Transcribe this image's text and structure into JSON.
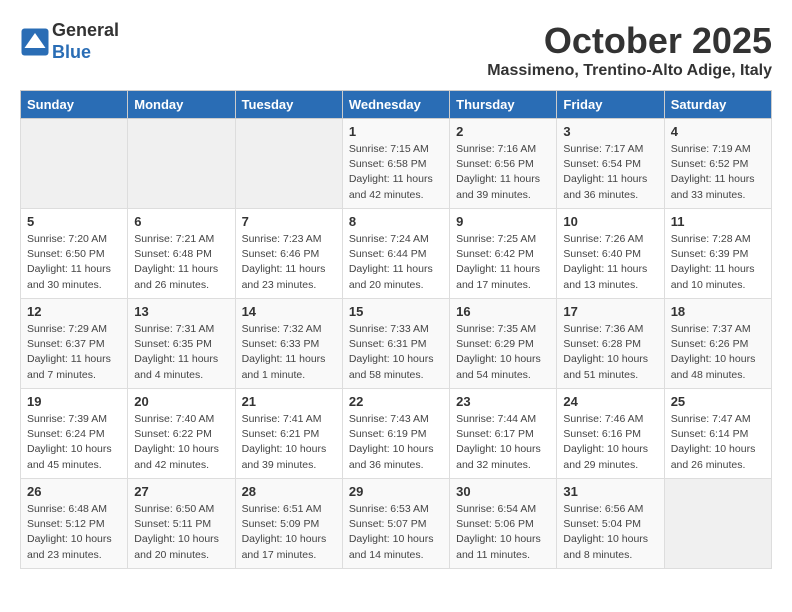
{
  "header": {
    "logo_line1": "General",
    "logo_line2": "Blue",
    "month": "October 2025",
    "location": "Massimeno, Trentino-Alto Adige, Italy"
  },
  "weekdays": [
    "Sunday",
    "Monday",
    "Tuesday",
    "Wednesday",
    "Thursday",
    "Friday",
    "Saturday"
  ],
  "weeks": [
    [
      {
        "day": "",
        "info": ""
      },
      {
        "day": "",
        "info": ""
      },
      {
        "day": "",
        "info": ""
      },
      {
        "day": "1",
        "info": "Sunrise: 7:15 AM\nSunset: 6:58 PM\nDaylight: 11 hours and 42 minutes."
      },
      {
        "day": "2",
        "info": "Sunrise: 7:16 AM\nSunset: 6:56 PM\nDaylight: 11 hours and 39 minutes."
      },
      {
        "day": "3",
        "info": "Sunrise: 7:17 AM\nSunset: 6:54 PM\nDaylight: 11 hours and 36 minutes."
      },
      {
        "day": "4",
        "info": "Sunrise: 7:19 AM\nSunset: 6:52 PM\nDaylight: 11 hours and 33 minutes."
      }
    ],
    [
      {
        "day": "5",
        "info": "Sunrise: 7:20 AM\nSunset: 6:50 PM\nDaylight: 11 hours and 30 minutes."
      },
      {
        "day": "6",
        "info": "Sunrise: 7:21 AM\nSunset: 6:48 PM\nDaylight: 11 hours and 26 minutes."
      },
      {
        "day": "7",
        "info": "Sunrise: 7:23 AM\nSunset: 6:46 PM\nDaylight: 11 hours and 23 minutes."
      },
      {
        "day": "8",
        "info": "Sunrise: 7:24 AM\nSunset: 6:44 PM\nDaylight: 11 hours and 20 minutes."
      },
      {
        "day": "9",
        "info": "Sunrise: 7:25 AM\nSunset: 6:42 PM\nDaylight: 11 hours and 17 minutes."
      },
      {
        "day": "10",
        "info": "Sunrise: 7:26 AM\nSunset: 6:40 PM\nDaylight: 11 hours and 13 minutes."
      },
      {
        "day": "11",
        "info": "Sunrise: 7:28 AM\nSunset: 6:39 PM\nDaylight: 11 hours and 10 minutes."
      }
    ],
    [
      {
        "day": "12",
        "info": "Sunrise: 7:29 AM\nSunset: 6:37 PM\nDaylight: 11 hours and 7 minutes."
      },
      {
        "day": "13",
        "info": "Sunrise: 7:31 AM\nSunset: 6:35 PM\nDaylight: 11 hours and 4 minutes."
      },
      {
        "day": "14",
        "info": "Sunrise: 7:32 AM\nSunset: 6:33 PM\nDaylight: 11 hours and 1 minute."
      },
      {
        "day": "15",
        "info": "Sunrise: 7:33 AM\nSunset: 6:31 PM\nDaylight: 10 hours and 58 minutes."
      },
      {
        "day": "16",
        "info": "Sunrise: 7:35 AM\nSunset: 6:29 PM\nDaylight: 10 hours and 54 minutes."
      },
      {
        "day": "17",
        "info": "Sunrise: 7:36 AM\nSunset: 6:28 PM\nDaylight: 10 hours and 51 minutes."
      },
      {
        "day": "18",
        "info": "Sunrise: 7:37 AM\nSunset: 6:26 PM\nDaylight: 10 hours and 48 minutes."
      }
    ],
    [
      {
        "day": "19",
        "info": "Sunrise: 7:39 AM\nSunset: 6:24 PM\nDaylight: 10 hours and 45 minutes."
      },
      {
        "day": "20",
        "info": "Sunrise: 7:40 AM\nSunset: 6:22 PM\nDaylight: 10 hours and 42 minutes."
      },
      {
        "day": "21",
        "info": "Sunrise: 7:41 AM\nSunset: 6:21 PM\nDaylight: 10 hours and 39 minutes."
      },
      {
        "day": "22",
        "info": "Sunrise: 7:43 AM\nSunset: 6:19 PM\nDaylight: 10 hours and 36 minutes."
      },
      {
        "day": "23",
        "info": "Sunrise: 7:44 AM\nSunset: 6:17 PM\nDaylight: 10 hours and 32 minutes."
      },
      {
        "day": "24",
        "info": "Sunrise: 7:46 AM\nSunset: 6:16 PM\nDaylight: 10 hours and 29 minutes."
      },
      {
        "day": "25",
        "info": "Sunrise: 7:47 AM\nSunset: 6:14 PM\nDaylight: 10 hours and 26 minutes."
      }
    ],
    [
      {
        "day": "26",
        "info": "Sunrise: 6:48 AM\nSunset: 5:12 PM\nDaylight: 10 hours and 23 minutes."
      },
      {
        "day": "27",
        "info": "Sunrise: 6:50 AM\nSunset: 5:11 PM\nDaylight: 10 hours and 20 minutes."
      },
      {
        "day": "28",
        "info": "Sunrise: 6:51 AM\nSunset: 5:09 PM\nDaylight: 10 hours and 17 minutes."
      },
      {
        "day": "29",
        "info": "Sunrise: 6:53 AM\nSunset: 5:07 PM\nDaylight: 10 hours and 14 minutes."
      },
      {
        "day": "30",
        "info": "Sunrise: 6:54 AM\nSunset: 5:06 PM\nDaylight: 10 hours and 11 minutes."
      },
      {
        "day": "31",
        "info": "Sunrise: 6:56 AM\nSunset: 5:04 PM\nDaylight: 10 hours and 8 minutes."
      },
      {
        "day": "",
        "info": ""
      }
    ]
  ]
}
